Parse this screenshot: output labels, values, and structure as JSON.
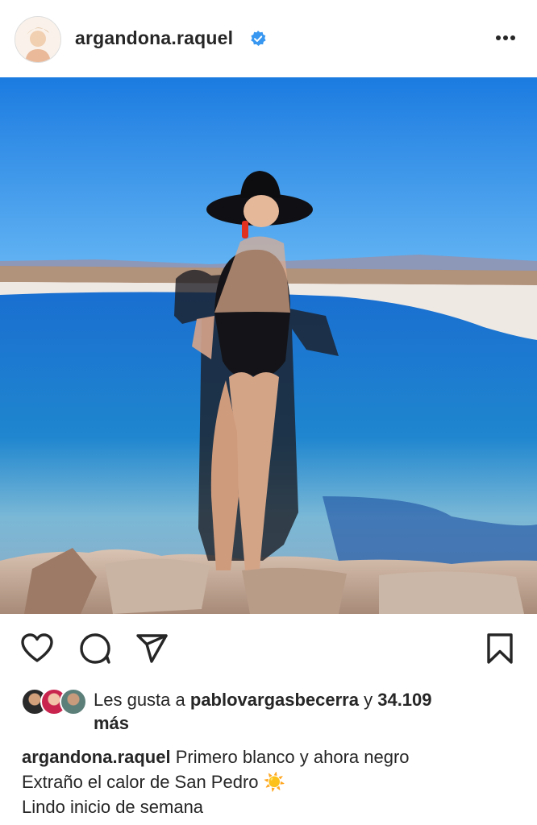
{
  "header": {
    "username": "argandona.raquel",
    "verified_icon": "verified-badge-icon",
    "more_icon": "more-options-icon"
  },
  "post": {
    "image_alt": "Woman in black swimsuit and wide-brim hat standing by a blue lagoon",
    "actions": {
      "like_icon": "heart-icon",
      "comment_icon": "comment-icon",
      "share_icon": "send-icon",
      "save_icon": "bookmark-icon"
    },
    "likes": {
      "prefix": "Les gusta a ",
      "user": "pablovargasbecerra",
      "middle": " y ",
      "count": "34.109",
      "suffix": "más"
    },
    "caption": {
      "username": "argandona.raquel",
      "line1": " Primero blanco y ahora negro",
      "line2": "Extraño el calor de San Pedro ",
      "line2_emoji": "☀️",
      "line3": "Lindo inicio de semana"
    }
  },
  "colors": {
    "verified_blue": "#3897f0",
    "text": "#262626",
    "sky": "#2f8fe6",
    "lagoon": "#1e73c2"
  }
}
